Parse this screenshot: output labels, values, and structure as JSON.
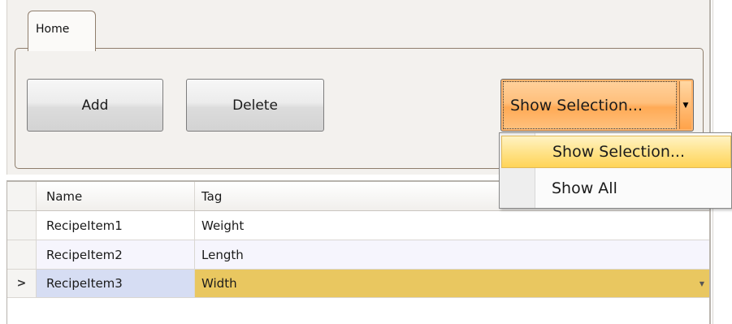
{
  "ribbon": {
    "tab_label": "Home",
    "buttons": {
      "add_label": "Add",
      "delete_label": "Delete",
      "show_selection_label": "Show Selection..."
    }
  },
  "dropdown_menu": {
    "items": [
      {
        "label": "Show Selection...",
        "highlighted": true
      },
      {
        "label": "Show All",
        "highlighted": false
      }
    ]
  },
  "grid": {
    "columns": [
      "Name",
      "Tag"
    ],
    "rows": [
      {
        "name": "RecipeItem1",
        "tag": "Weight"
      },
      {
        "name": "RecipeItem2",
        "tag": "Length"
      },
      {
        "name": "RecipeItem3",
        "tag": "Width",
        "current": true
      }
    ]
  },
  "icons": {
    "split_arrow": "dropdown-arrow-icon",
    "row_indicator": "current-row-indicator-icon",
    "cell_dropdown": "cell-dropdown-icon"
  },
  "colors": {
    "accent_orange": "#ffb36b",
    "menu_highlight": "#ffe38a",
    "selected_cell": "#e9c760",
    "selected_row_header": "#d6ddf3"
  }
}
